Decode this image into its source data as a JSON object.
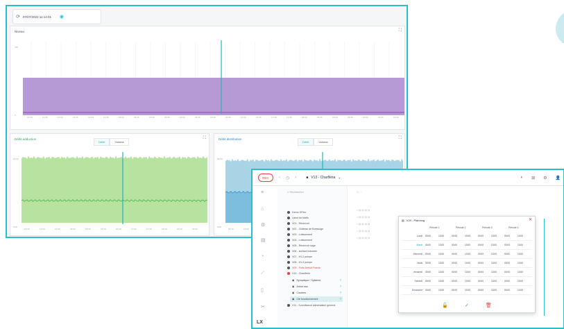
{
  "window1": {
    "toolbar": {
      "refresh_icon": "refresh-icon",
      "datetime": "07/07/2022 11:14:01",
      "wifi_icon": "wifi-icon"
    },
    "top_panel": {
      "title": "Niveau",
      "y_top_label": "100",
      "y_bottom_label": "0",
      "x_labels": [
        "13:30",
        "13:45",
        "14:00",
        "14:15",
        "14:30",
        "14:45",
        "15:00",
        "15:15",
        "15:30",
        "15:45",
        "16:00",
        "16:15",
        "16:30",
        "16:45",
        "17:00",
        "17:15",
        "17:30",
        "17:45",
        "18:00",
        "18:15",
        "18:30",
        "18:45",
        "19:00",
        "19:15",
        "19:30"
      ],
      "fill_color": "#b69ad6",
      "line_color": "#8e44ad"
    },
    "left_panel": {
      "title": "Débit adduction",
      "seg_options": [
        "Débit",
        "Volume"
      ],
      "y_top_label": "22.00",
      "y_bottom_label": "0.00",
      "x_labels": [
        "13:30",
        "14:00",
        "14:30",
        "15:00",
        "15:30",
        "16:00",
        "16:30",
        "17:00",
        "17:30",
        "18:00",
        "18:30",
        "19:00"
      ],
      "fill_color": "#b8e2a0"
    },
    "right_panel": {
      "title": "Débit distribution",
      "seg_options": [
        "Débit",
        "Volume"
      ],
      "y_top_label": "40.00",
      "y_bottom_label": "0.00",
      "x_labels": [
        "13:30",
        "14:00",
        "14:30"
      ],
      "fill_color": "#a8d4e6"
    },
    "cursor_color": "#27b3a8"
  },
  "window2": {
    "record_label": "REC",
    "title": "V13 - Charfleria",
    "search_placeholder": "Rechercher",
    "tree": {
      "items": [
        "Demo GFlex",
        "Usine de Mafik",
        "V01 - Réservoir",
        "V02 - Château de Bressuige",
        "V03 - Lotissement",
        "V04 - Lotissement",
        "V05 - Réservoir sage",
        "V06 - surface industrie",
        "V07 - H1.2 pompe",
        "V08 - H1.3 pompe",
        "V09 - Puits Déficit Pinède",
        "V10 - Chaufferie",
        "V11 - Surveillance alimentation général"
      ],
      "subitems": [
        "Synoptique / Système",
        "Arrivé eau",
        "Courbes",
        "Clé fonctionnement"
      ],
      "selected_index": 3,
      "bottom_item": "V11 - Surveillance alimentation général"
    },
    "modal": {
      "title": "V29 - Planning",
      "periods": [
        "Période 1",
        "Période 2",
        "Période 3",
        "Période 4"
      ],
      "days": [
        "Lundi",
        "Mardi",
        "Mercredi",
        "Jeudi",
        "Vendredi",
        "Samedi",
        "Dimanche"
      ],
      "highlight_day_index": 1,
      "row_values": [
        "00:00",
        "13:00",
        "00:00",
        "13:00",
        "00:00",
        "13:00",
        "00:00",
        "13:00"
      ]
    },
    "side_icons": [
      "menu-icon",
      "home-icon",
      "calendar-icon",
      "alarm-icon",
      "chart-icon",
      "document-icon",
      "tool-icon"
    ],
    "logo": "LX"
  }
}
